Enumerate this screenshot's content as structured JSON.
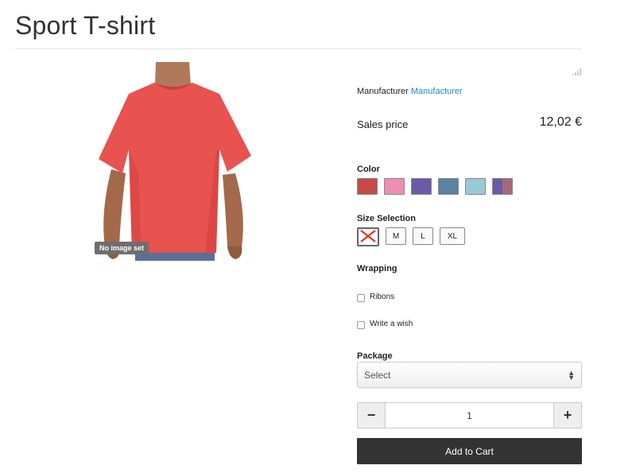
{
  "page": {
    "title": "Sport T-shirt"
  },
  "image": {
    "badge": "No image set",
    "shirt_color": "#e8524f"
  },
  "manufacturer": {
    "label": "Manufacturer",
    "link": "Manufacturer"
  },
  "price": {
    "label": "Sales price",
    "value": "12,02 €"
  },
  "color": {
    "label": "Color",
    "swatches": [
      {
        "name": "red",
        "color": "#c64a48"
      },
      {
        "name": "pink",
        "color": "#ee8fb1"
      },
      {
        "name": "purple",
        "color": "#6a5ba7"
      },
      {
        "name": "steel-blue",
        "color": "#5b83a0"
      },
      {
        "name": "light-blue",
        "color": "#9ac8d6"
      },
      {
        "name": "purple-mauve",
        "color_left": "#6a5ba7",
        "color_right": "#a66a7d"
      }
    ]
  },
  "size": {
    "label": "Size Selection",
    "options": [
      {
        "label": "",
        "icon": "cross-icon",
        "unavailable": true
      },
      {
        "label": "M"
      },
      {
        "label": "L"
      },
      {
        "label": "XL"
      }
    ]
  },
  "wrapping": {
    "label": "Wrapping",
    "options": [
      {
        "label": "Ribons",
        "checked": false
      },
      {
        "label": "Write a wish",
        "checked": false
      }
    ]
  },
  "package": {
    "label": "Package",
    "selected": "Select"
  },
  "quantity": {
    "minus": "−",
    "value": "1",
    "plus": "+"
  },
  "cart": {
    "label": "Add to Cart"
  }
}
